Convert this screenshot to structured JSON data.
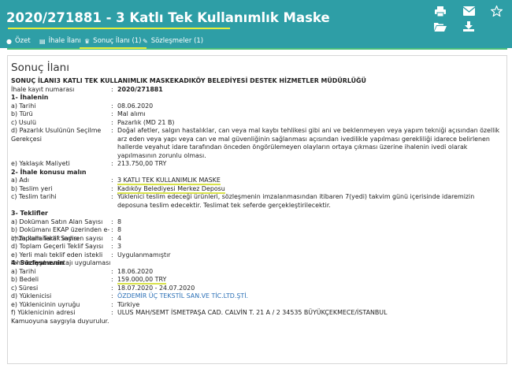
{
  "header": {
    "title": "2020/271881 - 3 Katlı Tek Kullanımlık Maske",
    "icons": [
      "print-icon",
      "mail-icon",
      "star-icon",
      "folder-open-icon",
      "download-icon"
    ]
  },
  "tabs": [
    {
      "label": "Özet",
      "icon": "info-icon"
    },
    {
      "label": "İhale İlanı",
      "icon": "document-icon"
    },
    {
      "label": "Sonuç İlanı (1)",
      "icon": "trophy-icon"
    },
    {
      "label": "Sözleşmeler (1)",
      "icon": "edit-icon"
    }
  ],
  "page_title": "Sonuç İlanı",
  "heading": "SONUÇ İLANI3 KATLI TEK KULLANIMLIK MASKEKADIKÖY BELEDİYESİ DESTEK HİZMETLER MÜDÜRLÜĞÜ",
  "rows": [
    {
      "label": "İhale kayıt numarası",
      "value": "2020/271881",
      "bold": true
    },
    {
      "section": "1- İhalenin"
    },
    {
      "label": "a) Tarihi",
      "value": "08.06.2020"
    },
    {
      "label": "b) Türü",
      "value": "Mal alımı"
    },
    {
      "label": "c) Usulü",
      "value": "Pazarlık (MD 21 B)"
    },
    {
      "label": "d) Pazarlık Usulünün Seçilme Gerekçesi",
      "value": "Doğal afetler, salgın hastalıklar, can veya mal kaybı tehlikesi gibi ani ve beklenmeyen veya yapım tekniği açısından özellik arz eden veya yapı veya can ve mal güvenliğinin sağlanması açısından ivedilikle yapılması gerekliliği idarece belirlenen hallerde veyahut idare tarafından önceden öngörülemeyen olayların ortaya çıkması üzerine ihalenin ivedi olarak yapılmasının zorunlu olması."
    },
    {
      "label": "e) Yaklaşık Maliyeti",
      "value": "213.750,00 TRY"
    },
    {
      "section": "2- İhale konusu malın"
    },
    {
      "label": "a) Adı",
      "value": "3 KATLI TEK KULLANIMLIK MASKE",
      "highlight": true
    },
    {
      "label": "b) Teslim yeri",
      "value": "Kadıköy Belediyesi Merkez Deposu",
      "highlight": true
    },
    {
      "label": "c) Teslim tarihi",
      "value": "Yüklenici teslim edeceği ürünleri, sözleşmenin imzalanmasından itibaren 7(yedi) takvim günü içerisinde idaremizin deposuna teslim edecektir. Teslimat tek seferde gerçekleştirilecektir."
    },
    {
      "section": "3- Teklifler"
    },
    {
      "label": "a) Doküman Satın Alan Sayısı",
      "value": "8"
    },
    {
      "label": "b) Dokümanı EKAP üzerinden e-imza kullanarak indiren sayısı",
      "value": "8"
    },
    {
      "label": "c) Toplam Teklif Sayısı",
      "value": "4"
    },
    {
      "label": "d) Toplam Geçerli Teklif Sayısı",
      "value": "3"
    },
    {
      "label": "e) Yerli malı teklif eden istekli lehine fiyat avantajı uygulaması",
      "value": "Uygulanmamıştır"
    },
    {
      "section": "4- Sözleşmenin"
    },
    {
      "label": "a) Tarihi",
      "value": "18.06.2020"
    },
    {
      "label": "b) Bedeli",
      "value": "159.000,00 TRY",
      "highlight": true
    },
    {
      "label": "c) Süresi",
      "value": "18.07.2020 - 24.07.2020"
    },
    {
      "label": "d) Yüklenicisi",
      "value": "ÖZDEMİR ÜÇ TEKSTİL SAN.VE TİC.LTD.ŞTİ.",
      "link": true
    },
    {
      "label": "e) Yüklenicinin uyruğu",
      "value": "Türkiye"
    },
    {
      "label": "f) Yüklenicinin adresi",
      "value": "ULUS MAH/SEMT İSMETPAŞA CAD. CALVİN T. 21 A / 2 34535 BÜYÜKÇEKMECE/İSTANBUL"
    }
  ],
  "footer_text": "Kamuoyuna saygıyla duyurulur."
}
